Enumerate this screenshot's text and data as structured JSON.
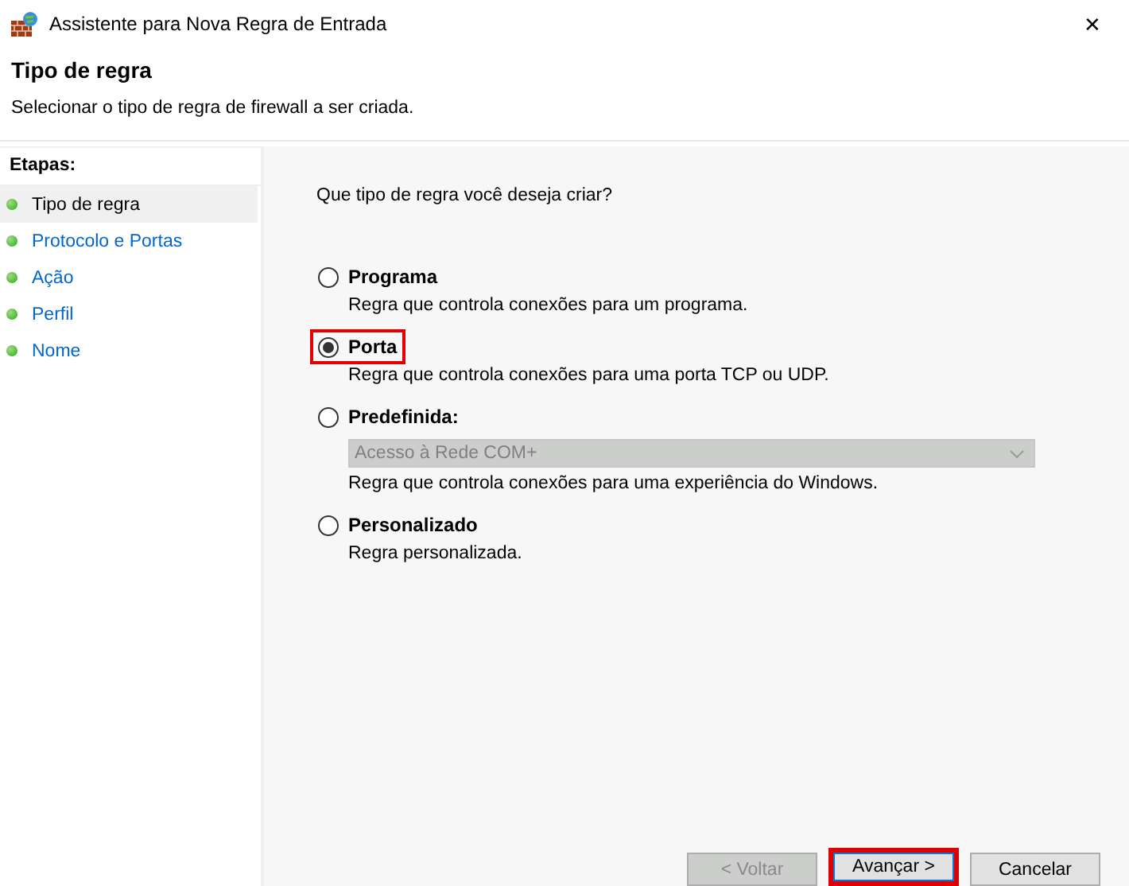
{
  "window": {
    "title": "Assistente para Nova Regra de Entrada",
    "close": "✕"
  },
  "header": {
    "title": "Tipo de regra",
    "subtitle": "Selecionar o tipo de regra de firewall a ser criada."
  },
  "sidebar": {
    "heading": "Etapas:",
    "items": [
      {
        "label": "Tipo de regra",
        "selected": true
      },
      {
        "label": "Protocolo e Portas",
        "selected": false
      },
      {
        "label": "Ação",
        "selected": false
      },
      {
        "label": "Perfil",
        "selected": false
      },
      {
        "label": "Nome",
        "selected": false
      }
    ]
  },
  "question": "Que tipo de regra você deseja criar?",
  "options": [
    {
      "label": "Programa",
      "description": "Regra que controla conexões para um programa.",
      "selected": false,
      "highlighted": false
    },
    {
      "label": "Porta",
      "description": "Regra que controla conexões para uma porta TCP ou UDP.",
      "selected": true,
      "highlighted": true
    },
    {
      "label": "Predefinida:",
      "description": "Regra que controla conexões para uma experiência do Windows.",
      "selected": false,
      "highlighted": false,
      "dropdown": {
        "value": "Acesso à Rede COM+",
        "disabled": true
      }
    },
    {
      "label": "Personalizado",
      "description": "Regra personalizada.",
      "selected": false,
      "highlighted": false
    }
  ],
  "buttons": [
    {
      "label": "< Voltar",
      "disabled": true,
      "highlighted": false
    },
    {
      "label": "Avançar >",
      "disabled": false,
      "highlighted": true
    },
    {
      "label": "Cancelar",
      "disabled": false,
      "highlighted": false
    }
  ]
}
